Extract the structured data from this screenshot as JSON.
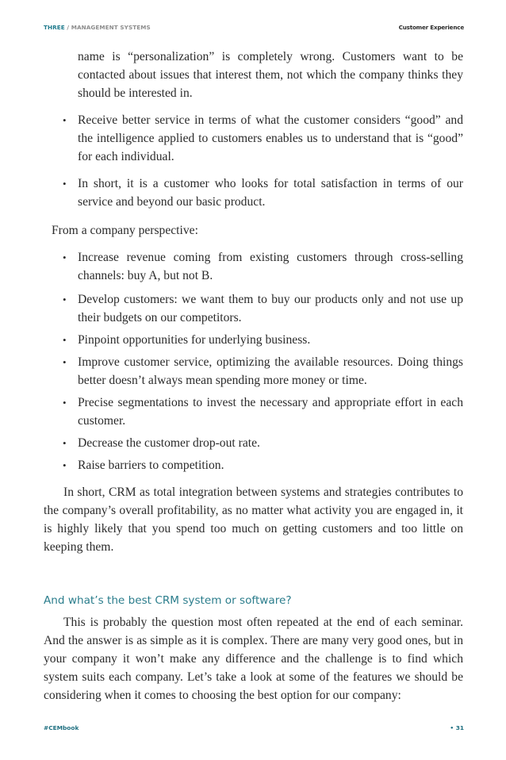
{
  "header": {
    "chapter_number": "THREE",
    "separator": " / ",
    "chapter_name": "MANAGEMENT SYSTEMS",
    "book_title": "Customer Experience"
  },
  "body": {
    "continued_text": "name is “personalization” is completely wrong. Customers want to be contacted about issues that interest them, not which the company thinks they should be interested in.",
    "customer_bullets": [
      "Receive better service in terms of what the customer considers “good” and the intelligence applied to customers enables us to understand that is “good” for each individual.",
      "In short, it is a customer who looks for total satisfaction in terms of our service and beyond our basic product."
    ],
    "company_subhead": "From a company perspective:",
    "company_bullets": [
      "Increase revenue coming from existing customers through cross-selling channels: buy A, but not B.",
      "Develop customers: we want them to buy our products only and not use up their budgets on our competitors.",
      "Pinpoint opportunities for underlying business.",
      "Improve customer service, optimizing the available resources. Doing things better doesn’t always mean spending more money or time.",
      "Precise segmentations to invest the necessary and appropriate effort in each customer.",
      "Decrease the customer drop-out rate.",
      "Raise barriers to competition."
    ],
    "summary_paragraph": "In short, CRM as total integration between systems and strategies contributes to the company’s overall profitability, as no matter what activity you are engaged in, it is highly likely that you spend too much on getting customers and too little on keeping them.",
    "section_heading": "And what’s the best CRM system or software?",
    "section_paragraph": "This is probably the question most often repeated at the end of each seminar. And the answer is as simple as it is complex. There are many very good ones, but in your company it won’t make any difference and the challenge is to find which system suits each company. Let’s take a look at some of the features we should be considering when it comes to choosing the best option for our company:"
  },
  "bullet_glyph": "•",
  "footer": {
    "hashtag": "#CEMbook",
    "page_number": "• 31"
  },
  "colors": {
    "accent": "#1e7a8c",
    "heading": "#2b7d8c",
    "header_gray": "#8d8d8d",
    "body_text": "#2b2b2b"
  }
}
